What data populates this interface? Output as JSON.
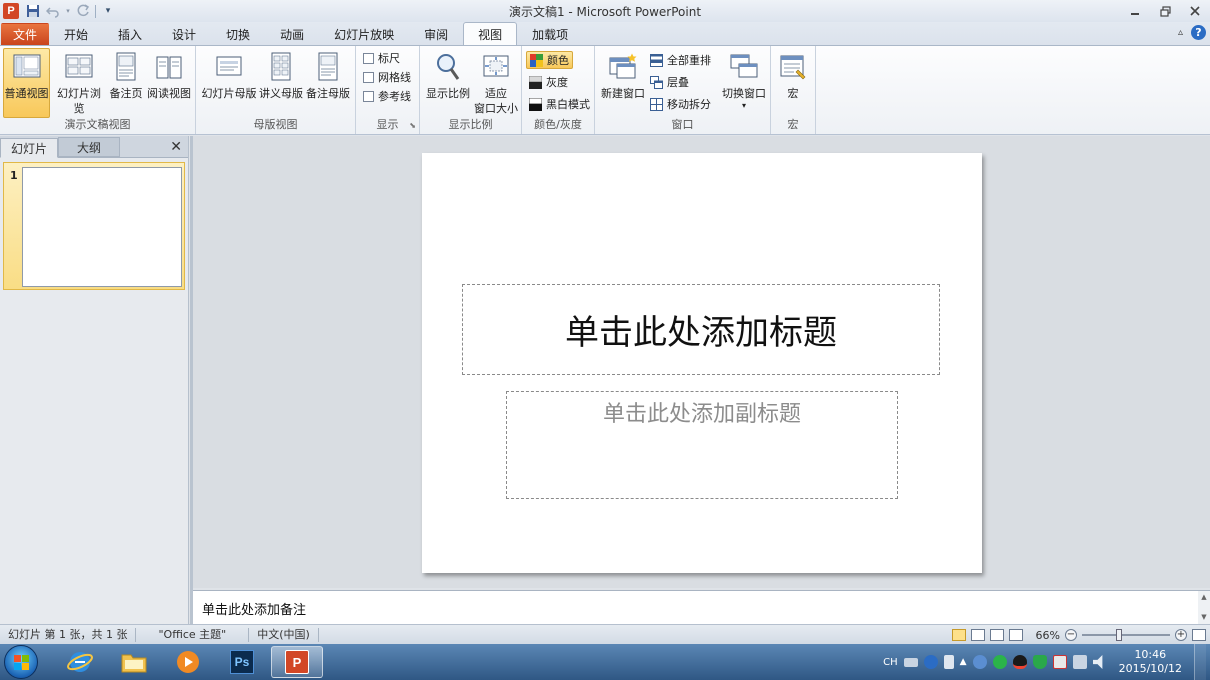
{
  "window": {
    "title": "演示文稿1 - Microsoft PowerPoint",
    "app_icon_letter": "P"
  },
  "tabs": [
    {
      "label": "文件"
    },
    {
      "label": "开始"
    },
    {
      "label": "插入"
    },
    {
      "label": "设计"
    },
    {
      "label": "切换"
    },
    {
      "label": "动画"
    },
    {
      "label": "幻灯片放映"
    },
    {
      "label": "审阅"
    },
    {
      "label": "视图"
    },
    {
      "label": "加载项"
    }
  ],
  "ribbon": {
    "presentation_views": {
      "label": "演示文稿视图",
      "normal": "普通视图",
      "slide_sorter": "幻灯片浏览",
      "notes_page": "备注页",
      "reading_view": "阅读视图"
    },
    "master_views": {
      "label": "母版视图",
      "slide_master": "幻灯片母版",
      "handout_master": "讲义母版",
      "notes_master": "备注母版"
    },
    "show": {
      "label": "显示",
      "ruler": "标尺",
      "gridlines": "网格线",
      "guides": "参考线"
    },
    "zoom": {
      "label": "显示比例",
      "zoom": "显示比例",
      "fit_line1": "适应",
      "fit_line2": "窗口大小"
    },
    "color": {
      "label": "颜色/灰度",
      "color": "颜色",
      "grayscale": "灰度",
      "bw": "黑白模式"
    },
    "window": {
      "label": "窗口",
      "new_window": "新建窗口",
      "arrange_all": "全部重排",
      "cascade": "层叠",
      "move_split": "移动拆分",
      "switch_windows": "切换窗口"
    },
    "macros": {
      "label": "宏",
      "macros": "宏"
    }
  },
  "left_pane": {
    "tab_slides": "幻灯片",
    "tab_outline": "大纲",
    "slide_number": "1"
  },
  "slide": {
    "title_placeholder": "单击此处添加标题",
    "subtitle_placeholder": "单击此处添加副标题"
  },
  "notes": {
    "placeholder": "单击此处添加备注"
  },
  "status": {
    "slide_info": "幻灯片 第 1 张，共 1 张",
    "theme": "\"Office 主题\"",
    "language": "中文(中国)",
    "zoom": "66%"
  },
  "taskbar": {
    "input_lang": "CH",
    "time": "10:46",
    "date": "2015/10/12"
  },
  "colors": {
    "file_tab": "#d24726",
    "active_button": "#f8c85a"
  }
}
